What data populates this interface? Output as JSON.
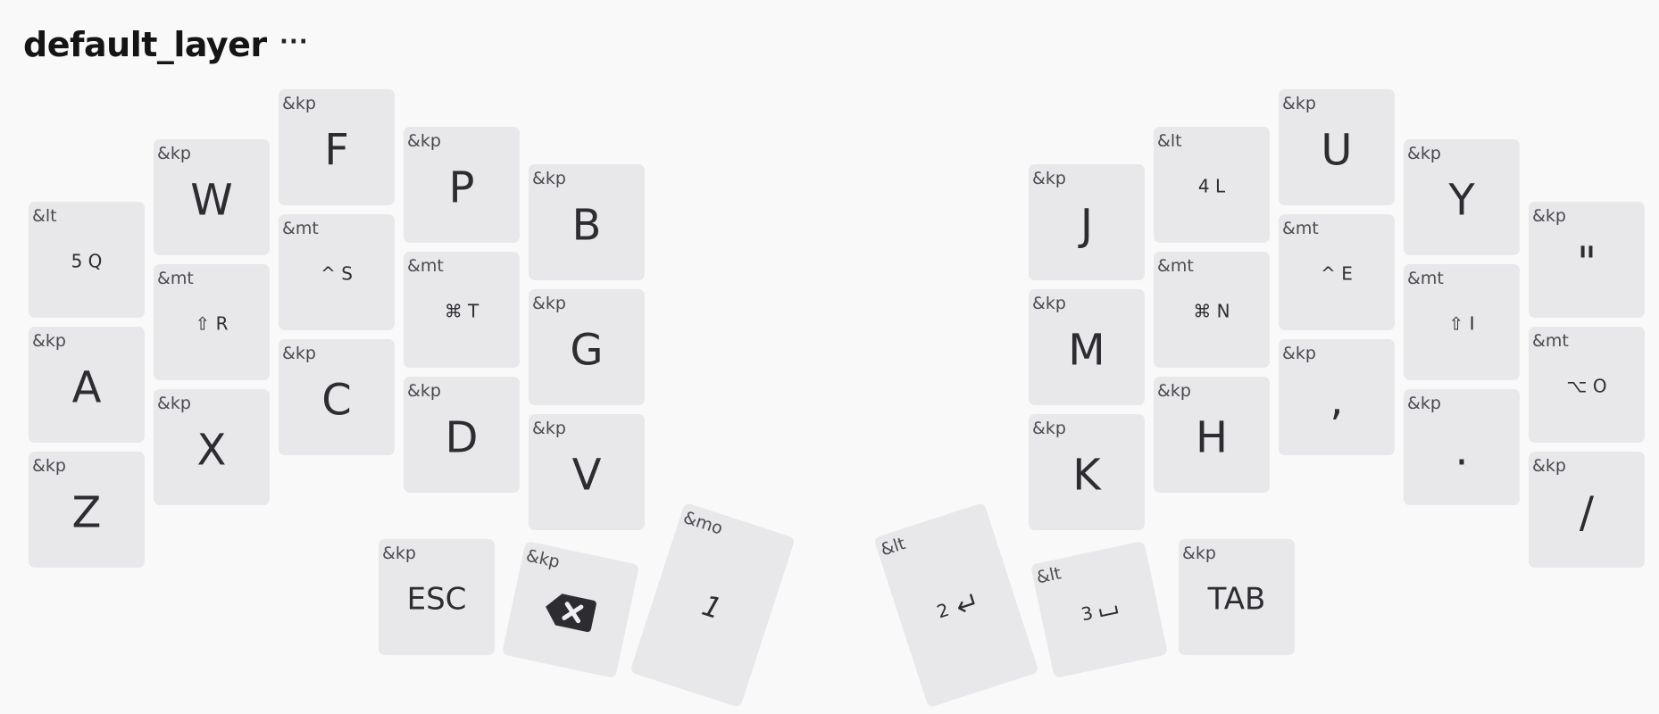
{
  "header": {
    "layer_name": "default_layer",
    "menu_label": "···"
  },
  "keys": {
    "q": {
      "binding": "&lt",
      "legend": "5 Q"
    },
    "w": {
      "binding": "&kp",
      "legend": "W"
    },
    "f": {
      "binding": "&kp",
      "legend": "F"
    },
    "p": {
      "binding": "&kp",
      "legend": "P"
    },
    "b": {
      "binding": "&kp",
      "legend": "B"
    },
    "a": {
      "binding": "&kp",
      "legend": "A"
    },
    "r": {
      "binding": "&mt",
      "legend": "⇧ R"
    },
    "s": {
      "binding": "&mt",
      "legend": "^ S"
    },
    "t": {
      "binding": "&mt",
      "legend": "⌘ T"
    },
    "g": {
      "binding": "&kp",
      "legend": "G"
    },
    "z": {
      "binding": "&kp",
      "legend": "Z"
    },
    "x": {
      "binding": "&kp",
      "legend": "X"
    },
    "c": {
      "binding": "&kp",
      "legend": "C"
    },
    "d": {
      "binding": "&kp",
      "legend": "D"
    },
    "v": {
      "binding": "&kp",
      "legend": "V"
    },
    "esc": {
      "binding": "&kp",
      "legend": "ESC"
    },
    "bksp": {
      "binding": "&kp",
      "legend": "",
      "icon": "backspace-icon"
    },
    "mo1": {
      "binding": "&mo",
      "legend": "1"
    },
    "ret": {
      "binding": "&lt",
      "legend": "2",
      "icon": "return-icon"
    },
    "spc": {
      "binding": "&lt",
      "legend": "3",
      "icon": "space-icon"
    },
    "tab": {
      "binding": "&kp",
      "legend": "TAB"
    },
    "j": {
      "binding": "&kp",
      "legend": "J"
    },
    "l": {
      "binding": "&lt",
      "legend": "4 L"
    },
    "u": {
      "binding": "&kp",
      "legend": "U"
    },
    "y": {
      "binding": "&kp",
      "legend": "Y"
    },
    "quot": {
      "binding": "&kp",
      "legend": "\""
    },
    "m": {
      "binding": "&kp",
      "legend": "M"
    },
    "n": {
      "binding": "&mt",
      "legend": "⌘ N"
    },
    "e": {
      "binding": "&mt",
      "legend": "^ E"
    },
    "i": {
      "binding": "&mt",
      "legend": "⇧ I"
    },
    "o": {
      "binding": "&mt",
      "legend": "⌥ O"
    },
    "k": {
      "binding": "&kp",
      "legend": "K"
    },
    "h": {
      "binding": "&kp",
      "legend": "H"
    },
    "comma": {
      "binding": "&kp",
      "legend": ","
    },
    "dot": {
      "binding": "&kp",
      "legend": "."
    },
    "slash": {
      "binding": "&kp",
      "legend": "/"
    }
  }
}
